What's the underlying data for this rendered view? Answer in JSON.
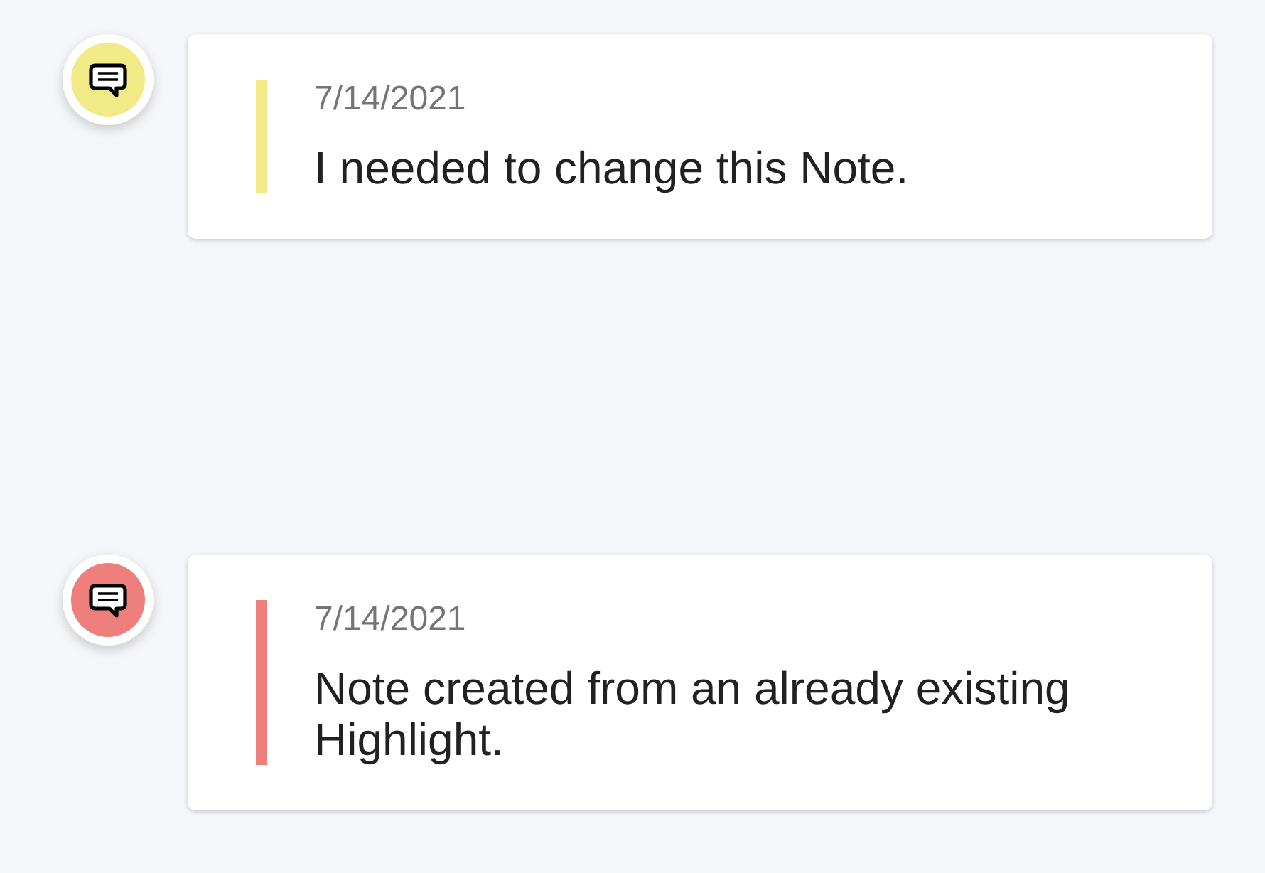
{
  "notes": [
    {
      "date": "7/14/2021",
      "text": "I needed to change this Note.",
      "color": "#f2ea87"
    },
    {
      "date": "7/14/2021",
      "text": "Note created from an already existing Highlight.",
      "color": "#ee7f7c"
    }
  ]
}
